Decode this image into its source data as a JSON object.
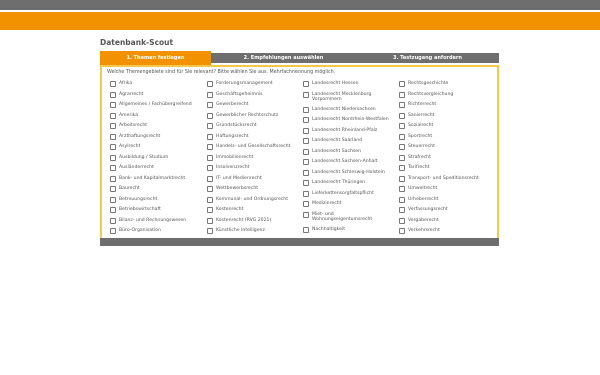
{
  "page_title": "Datenbank-Scout",
  "steps": [
    {
      "label": "1. Themen festlegen"
    },
    {
      "label": "2. Empfehlungen auswählen"
    },
    {
      "label": "3. Testzugang anfordern"
    }
  ],
  "instruction": "Welche Themengebiete sind für Sie relevant? Bitte wählen Sie aus. Mehrfachnennung möglich.",
  "columns": [
    [
      "Afrika",
      "Agrarrecht",
      "Allgemeines / Fachübergreifend",
      "Amerika",
      "Arbeitsrecht",
      "Arzthaftungsrecht",
      "Asylrecht",
      "Ausbildung / Studium",
      "Ausländerrecht",
      "Bank- und Kapitalmarktrecht",
      "Baurecht",
      "Betreuungsrecht",
      "Betriebswirtschaft",
      "Bilanz- und Rechnungswesen",
      "Büro-Organisation"
    ],
    [
      "Forderungsmanagement",
      "Geschäftsgeheimnis",
      "Gewerberecht",
      "Gewerblicher Rechtsschutz",
      "Grundstücksrecht",
      "Haftungsrecht",
      "Handels- und Gesellschaftsrecht",
      "Immobilienrecht",
      "Insolvenzrecht",
      "IT- und Medienrecht",
      "Wettbewerbsrecht",
      "Kommunal- und Ordnungsrecht",
      "Kostenrecht",
      "Kostenrecht (RVG 2021)",
      "Künstliche Intelligenz"
    ],
    [
      "Landesrecht Hessen",
      "Landesrecht Mecklenburg Vorpommern",
      "Landesrecht Niedersachsen",
      "Landesrecht Nordrhein-Westfalen",
      "Landesrecht Rheinland-Pfalz",
      "Landesrecht Saarland",
      "Landesrecht Sachsen",
      "Landesrecht Sachsen-Anhalt",
      "Landesrecht Schleswig-Holstein",
      "Landesrecht Thüringen",
      "Lieferkettensorgfaltspflicht",
      "Medizinrecht",
      "Miet- und Wohnungseigentumsrecht",
      "Nachhaltigkeit"
    ],
    [
      "Rechtsgeschichte",
      "Rechtsvergleichung",
      "Richterrecht",
      "Sanierrecht",
      "Sozialrecht",
      "Sportrecht",
      "Steuerrecht",
      "Strafrecht",
      "Tarifrecht",
      "Transport- und Speditionsrecht",
      "Umweltrecht",
      "Urheberrecht",
      "Verfassungsrecht",
      "Vergaberecht",
      "Verkehrsrecht"
    ]
  ],
  "colors": {
    "accent": "#f39200",
    "bar": "#6e6e6e",
    "panel_border": "#f2c94c"
  }
}
